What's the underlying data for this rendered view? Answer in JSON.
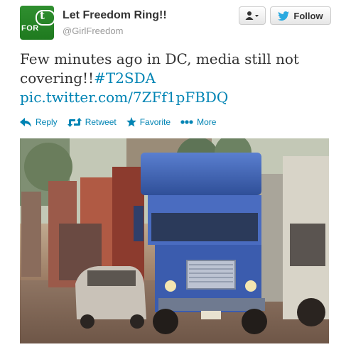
{
  "header": {
    "display_name": "Let Freedom Ring!!",
    "handle": "@GirlFreedom",
    "avatar_text": "FOR",
    "avatar_mark": "t"
  },
  "buttons": {
    "user_menu_icon": "person-icon",
    "follow_label": "Follow"
  },
  "tweet": {
    "text": "Few minutes ago in DC, media still not covering!!",
    "hashtag": "#T2SDA",
    "link": "pic.twitter.com/7ZFf1pFBDQ"
  },
  "actions": [
    {
      "label": "Reply",
      "icon": "reply-icon"
    },
    {
      "label": "Retweet",
      "icon": "retweet-icon"
    },
    {
      "label": "Favorite",
      "icon": "star-icon"
    },
    {
      "label": "More",
      "icon": "more-icon"
    }
  ],
  "colors": {
    "link": "#0084b4",
    "twitter_blue": "#2aa9e0",
    "avatar_green": "#2f8f2f",
    "truck_blue": "#3c64b8"
  }
}
